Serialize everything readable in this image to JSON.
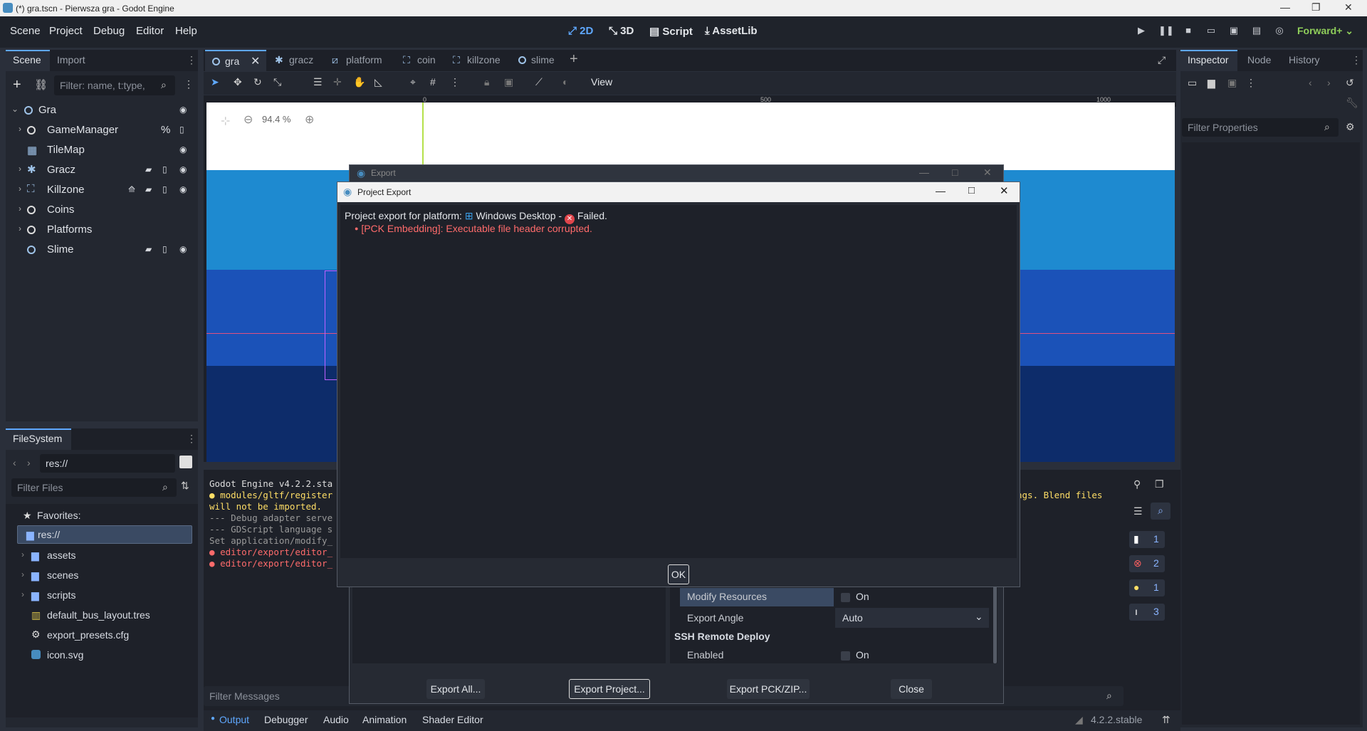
{
  "window": {
    "title": "(*) gra.tscn - Pierwsza gra - Godot Engine"
  },
  "menu": [
    "Scene",
    "Project",
    "Debug",
    "Editor",
    "Help"
  ],
  "workspaces": [
    "2D",
    "3D",
    "Script",
    "AssetLib"
  ],
  "renderer": "Forward+",
  "scene_dock": {
    "tabs": [
      "Scene",
      "Import"
    ],
    "filter_placeholder": "Filter: name, t:type,",
    "nodes": [
      "Gra",
      "GameManager",
      "TileMap",
      "Gracz",
      "Killzone",
      "Coins",
      "Platforms",
      "Slime"
    ],
    "gm_badge": "%"
  },
  "filesystem": {
    "title": "FileSystem",
    "path": "res://",
    "filter_placeholder": "Filter Files",
    "favorites": "Favorites:",
    "root": "res://",
    "items": [
      "assets",
      "scenes",
      "scripts",
      "default_bus_layout.tres",
      "export_presets.cfg",
      "icon.svg"
    ]
  },
  "scene_tabs": [
    "gra",
    "gracz",
    "platform",
    "coin",
    "killzone",
    "slime"
  ],
  "toolbar": {
    "view": "View"
  },
  "ruler": [
    "0",
    "500",
    "1000"
  ],
  "zoom": "94.4 %",
  "inspector": {
    "tabs": [
      "Inspector",
      "Node",
      "History"
    ],
    "filter_placeholder": "Filter Properties"
  },
  "output": {
    "lines": [
      "Godot Engine v4.2.2.sta",
      "modules/gltf/register",
      "will not be imported.",
      "--- Debug adapter serve",
      "--- GDScript language s",
      "Set application/modify_",
      "editor/export/editor_",
      "editor/export/editor_"
    ],
    "right_warning": "ngs. Blend files",
    "filter_placeholder": "Filter Messages",
    "counts": [
      "1",
      "2",
      "1",
      "3"
    ]
  },
  "bottom_tabs": [
    "Output",
    "Debugger",
    "Audio",
    "Animation",
    "Shader Editor"
  ],
  "version": "4.2.2.stable",
  "export_dialog": {
    "title": "Export",
    "props": [
      {
        "label": "Modify Resources",
        "value": "On"
      },
      {
        "label": "Export Angle",
        "value": "Auto"
      }
    ],
    "section": "SSH Remote Deploy",
    "enabled": {
      "label": "Enabled",
      "value": "On"
    },
    "buttons": [
      "Export All...",
      "Export Project...",
      "Export PCK/ZIP...",
      "Close"
    ]
  },
  "project_export": {
    "title": "Project Export",
    "prefix": "Project export for platform:",
    "platform": "Windows Desktop",
    "sep": "-",
    "status": "Failed.",
    "error": "[PCK Embedding]: Executable file header corrupted.",
    "ok": "OK"
  },
  "colors": {
    "accent": "#5fa8ff",
    "error": "#ff5f5f",
    "warning": "#ffde66"
  }
}
